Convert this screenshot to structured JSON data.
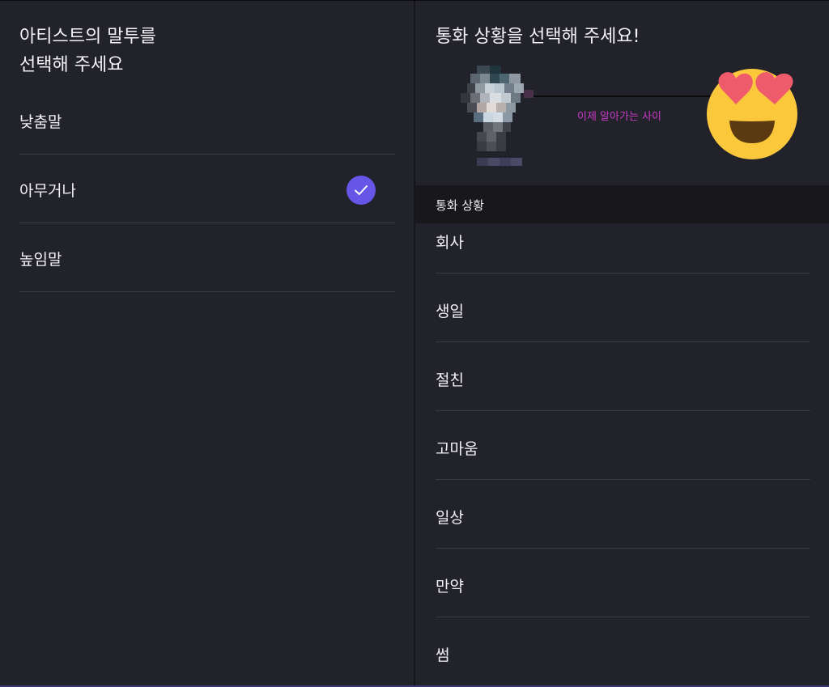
{
  "left": {
    "title_line1": "아티스트의 말투를",
    "title_line2": "선택해 주세요",
    "tones": [
      {
        "label": "낮춤말",
        "selected": false
      },
      {
        "label": "아무거나",
        "selected": true
      },
      {
        "label": "높임말",
        "selected": false
      }
    ]
  },
  "right": {
    "title": "통화 상황을 선택해 주세요!",
    "relation_label": "이제 알아가는 사이",
    "relation_emoji": "heart-eyes-emoji",
    "section_header": "통화 상황",
    "situations": [
      {
        "label": "회사"
      },
      {
        "label": "생일"
      },
      {
        "label": "절친"
      },
      {
        "label": "고마움"
      },
      {
        "label": "일상"
      },
      {
        "label": "만약"
      },
      {
        "label": "썸"
      }
    ]
  },
  "colors": {
    "background": "#22222b",
    "section_header_bg": "#18181c",
    "accent_check": "#6656e8",
    "relation_label": "#c83ac6",
    "divider": "#3a3a44"
  },
  "icons": {
    "selected_check": "check-icon"
  }
}
